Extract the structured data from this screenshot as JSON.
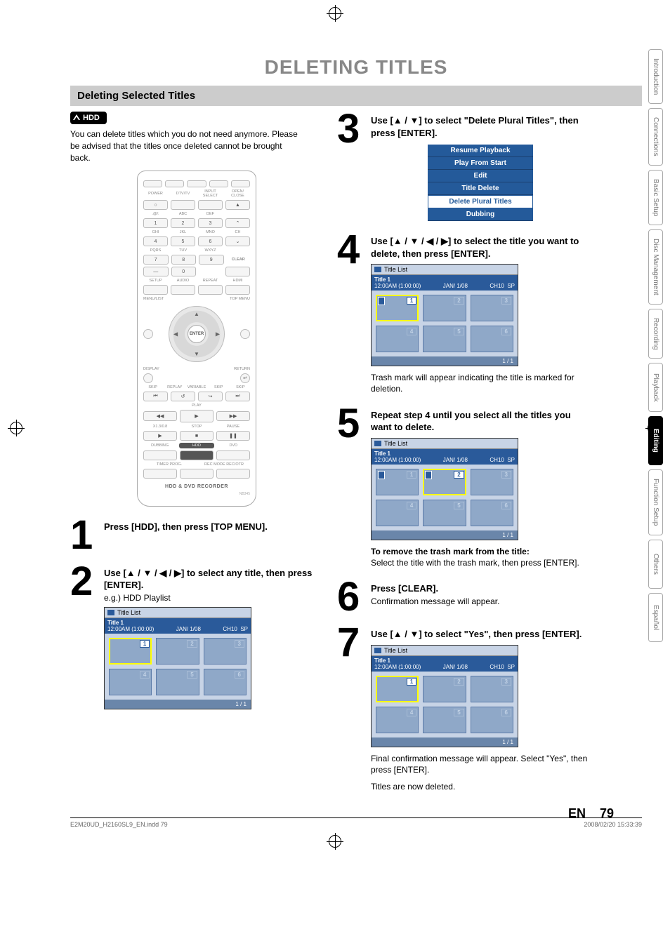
{
  "page": {
    "main_title": "DELETING TITLES",
    "section_title": "Deleting Selected Titles",
    "hdd_badge": "HDD",
    "intro": "You can delete titles which you do not need anymore. Please be advised that the titles once deleted cannot be brought back.",
    "page_lang": "EN",
    "page_number": "79"
  },
  "tabs": [
    {
      "label": "Introduction",
      "active": false
    },
    {
      "label": "Connections",
      "active": false
    },
    {
      "label": "Basic Setup",
      "active": false
    },
    {
      "label": "Disc Management",
      "active": false
    },
    {
      "label": "Recording",
      "active": false
    },
    {
      "label": "Playback",
      "active": false
    },
    {
      "label": "Editing",
      "active": true
    },
    {
      "label": "Function Setup",
      "active": false
    },
    {
      "label": "Others",
      "active": false
    },
    {
      "label": "Español",
      "active": false
    }
  ],
  "steps": {
    "s1": {
      "num": "1",
      "heading": "Press [HDD], then press [TOP MENU]."
    },
    "s2": {
      "num": "2",
      "heading": "Use [▲ / ▼ / ◀ / ▶] to select any title, then press [ENTER].",
      "sub": "e.g.) HDD Playlist"
    },
    "s3": {
      "num": "3",
      "heading": "Use [▲ / ▼] to select \"Delete Plural Titles\", then press [ENTER]."
    },
    "s4": {
      "num": "4",
      "heading": "Use [▲ / ▼ / ◀ / ▶] to select the title you want to delete, then press [ENTER].",
      "note": "Trash mark will appear indicating the title is marked for deletion."
    },
    "s5": {
      "num": "5",
      "heading": "Repeat step 4 until you select all the titles you want to delete.",
      "note_bold": "To remove the trash mark from the title:",
      "note": "Select the title with the trash mark, then press [ENTER]."
    },
    "s6": {
      "num": "6",
      "heading": "Press [CLEAR].",
      "sub": "Confirmation message will appear."
    },
    "s7": {
      "num": "7",
      "heading": "Use [▲ / ▼] to select \"Yes\", then press [ENTER].",
      "note": "Final confirmation message will appear. Select \"Yes\", then press [ENTER].",
      "note2": "Titles are now deleted."
    }
  },
  "menu": {
    "items": [
      "Resume Playback",
      "Play From Start",
      "Edit",
      "Title Delete",
      "Delete Plural Titles",
      "Dubbing"
    ],
    "selected_index": 4
  },
  "title_list": {
    "title": "Title List",
    "name": "Title 1",
    "time": "12:00AM (1:00:00)",
    "date": "JAN/ 1/08",
    "ch": "CH10",
    "mode": "SP",
    "page": "1 / 1"
  },
  "remote": {
    "row_lbls_1": [
      "POWER",
      "DTV/TV",
      "INPUT SELECT",
      "OPEN/ CLOSE"
    ],
    "keypad_top": [
      ".@/:",
      "ABC",
      "DEF"
    ],
    "keypad_nums": [
      "1",
      "2",
      "3",
      "4",
      "5",
      "6",
      "7",
      "8",
      "9"
    ],
    "keypad_mid": [
      "GHI",
      "JKL",
      "MNO",
      "PQRS",
      "TUV",
      "WXYZ"
    ],
    "ch_label": "CH",
    "zero": "0",
    "clear": "CLEAR",
    "row_lbls_3": [
      "SETUP",
      "AUDIO",
      "REPEAT",
      "HDMI"
    ],
    "menu_list": "MENU/LIST",
    "top_menu": "TOP MENU",
    "enter": "ENTER",
    "display": "DISPLAY",
    "return": "RETURN",
    "variable": "VARIABLE",
    "skip": "SKIP",
    "replay": "REPLAY",
    "play": "PLAY",
    "stop": "STOP",
    "pause": "PAUSE",
    "speed": "X1.3/0.8",
    "dubbing": "DUBBING",
    "hdd": "HDD",
    "dvd": "DVD",
    "timer": "TIMER PROG.",
    "rec": "REC MODE   REC/OTR",
    "brand": "HDD & DVD RECORDER",
    "model": "NB345"
  },
  "footer": {
    "left": "E2M20UD_H2160SL9_EN.indd   79",
    "right": "2008/02/20   15:33:39"
  }
}
